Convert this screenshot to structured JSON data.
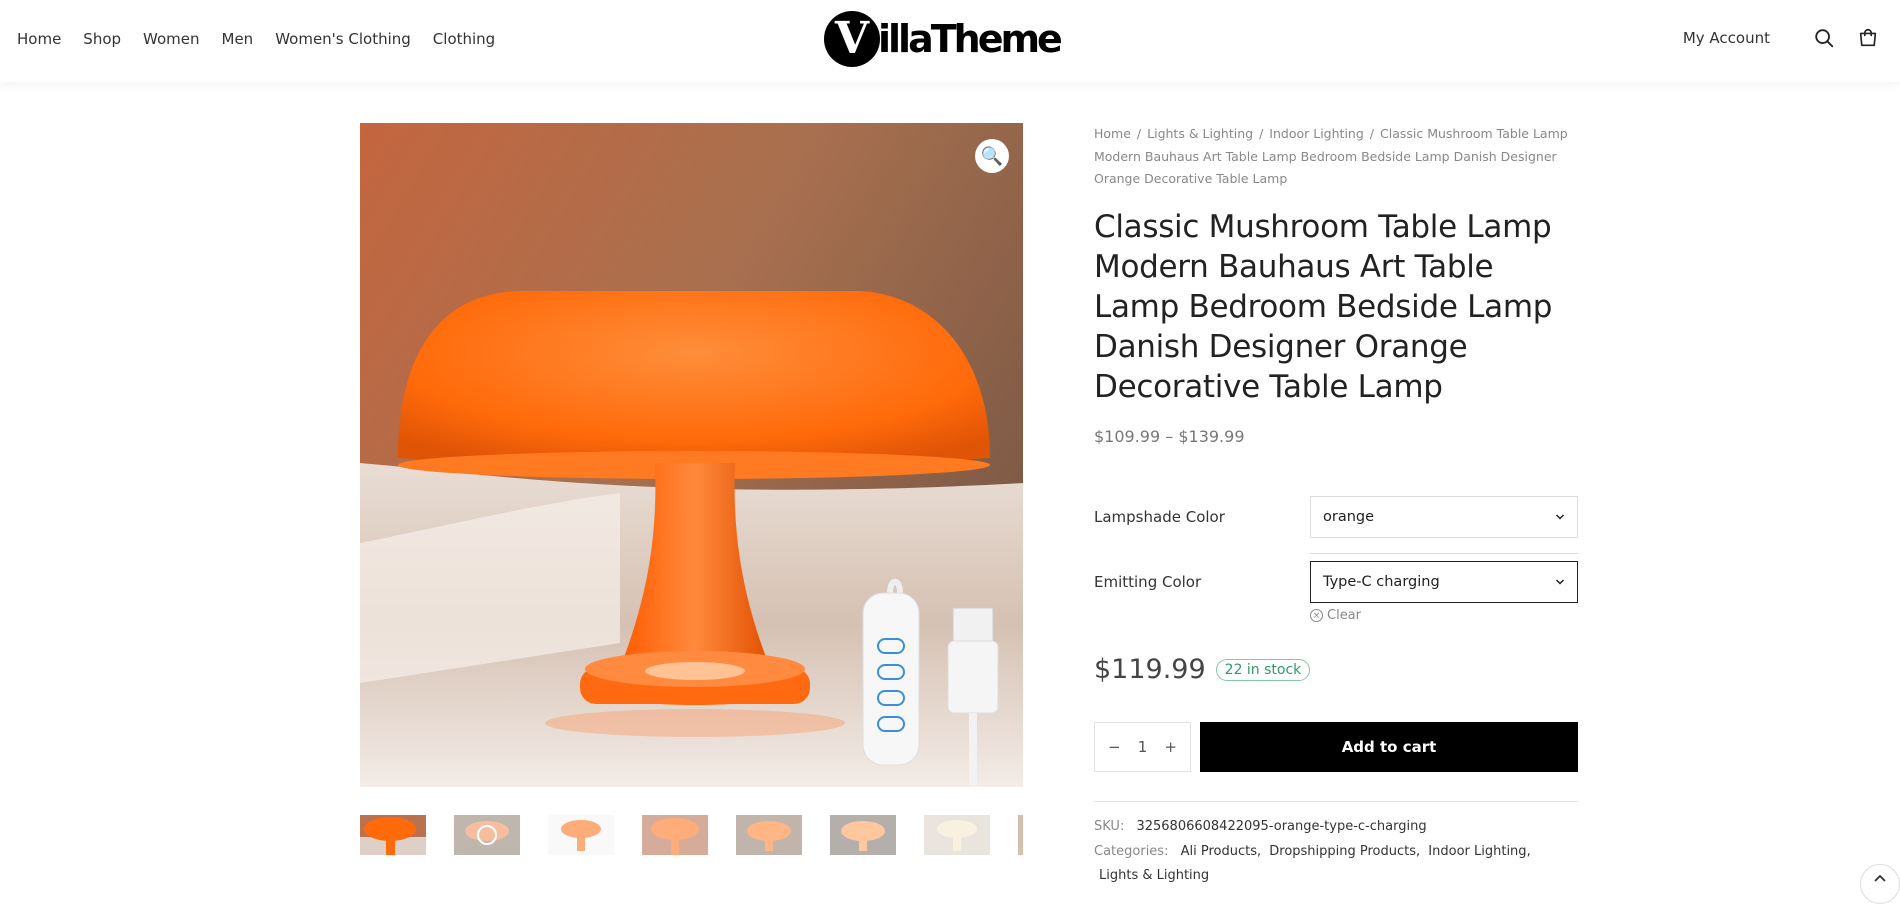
{
  "nav": {
    "items": [
      "Home",
      "Shop",
      "Women",
      "Men",
      "Women's Clothing",
      "Clothing"
    ]
  },
  "logo": {
    "mark": "V",
    "text": "illaTheme"
  },
  "header": {
    "account": "My Account"
  },
  "gallery": {
    "zoom_icon": "🔍",
    "thumbnail_count": 8
  },
  "breadcrumb": {
    "items": [
      "Home",
      "Lights & Lighting",
      "Indoor Lighting"
    ],
    "current": "Classic Mushroom Table Lamp Modern Bauhaus Art Table Lamp Bedroom Bedside Lamp Danish Designer Orange Decorative Table Lamp",
    "separator": "/"
  },
  "product": {
    "title": "Classic Mushroom Table Lamp Modern Bauhaus Art Table Lamp Bedroom Bedside Lamp Danish Designer Orange Decorative Table Lamp",
    "price_range": "$109.99 – $139.99",
    "price": "$119.99",
    "stock": "22 in stock"
  },
  "variations": {
    "lampshade_label": "Lampshade Color",
    "lampshade_value": "orange",
    "emitting_label": "Emitting Color",
    "emitting_value": "Type-C charging",
    "clear": "Clear"
  },
  "cart": {
    "minus": "−",
    "quantity": "1",
    "plus": "+",
    "add_to_cart": "Add to cart"
  },
  "meta": {
    "sku_label": "SKU:",
    "sku": "3256806608422095-orange-type-c-charging",
    "categories_label": "Categories:",
    "categories": [
      "Ali Products",
      "Dropshipping Products",
      "Indoor Lighting",
      "Lights & Lighting"
    ]
  },
  "colors": {
    "accent": "#000000",
    "stock_green": "#2f9a66",
    "lamp_orange": "#ff6a10"
  }
}
